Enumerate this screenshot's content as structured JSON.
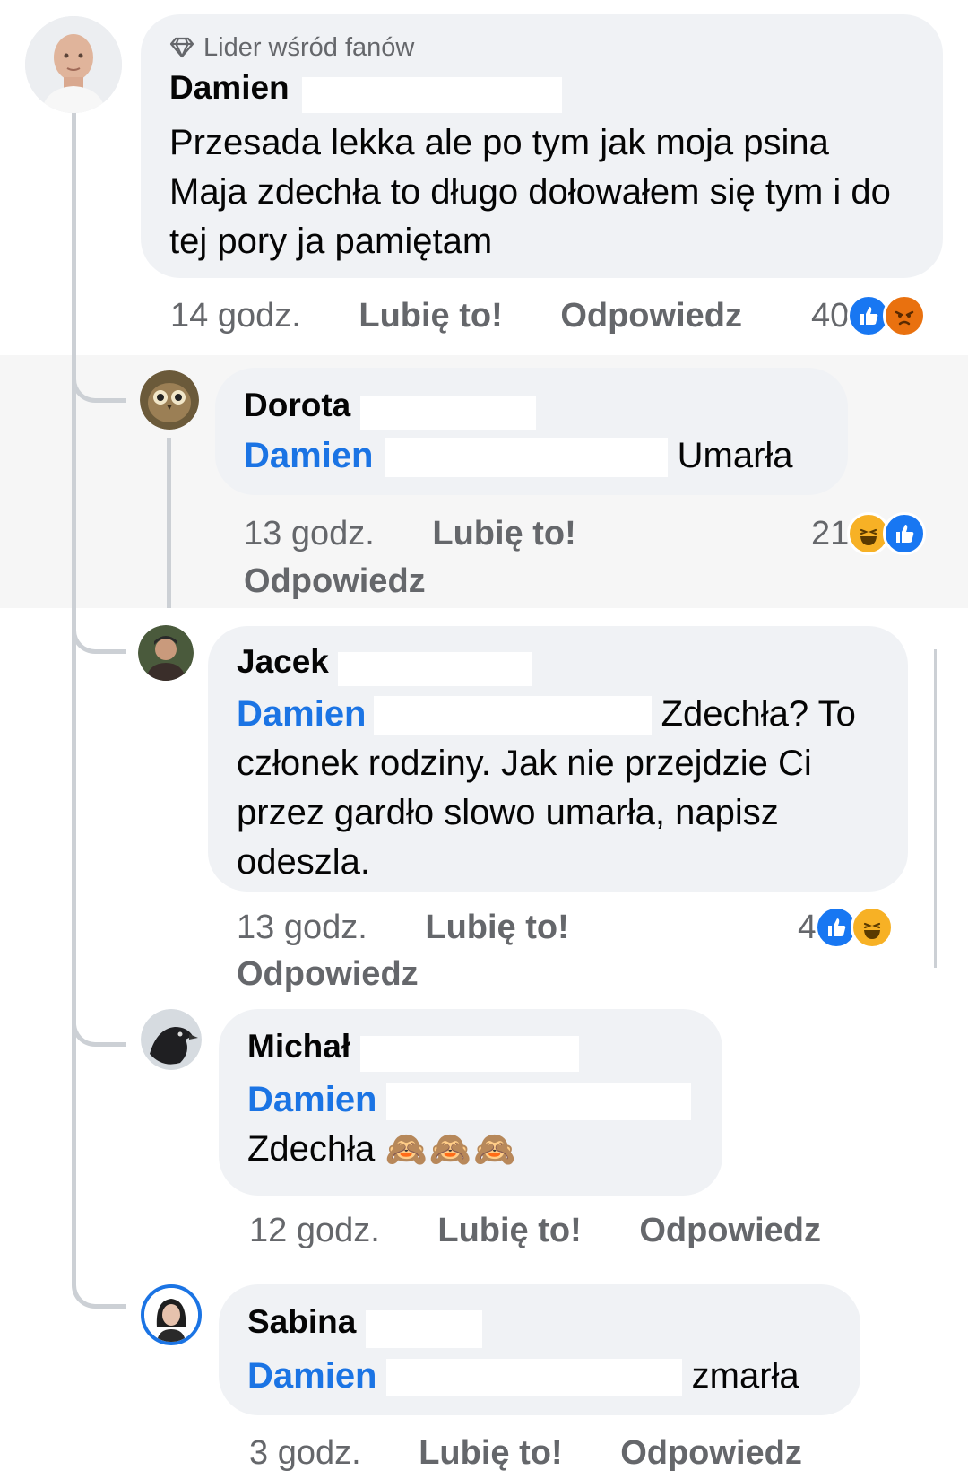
{
  "comments": [
    {
      "badge": "Lider wśród fanów",
      "author": "Damien",
      "text": "Przesada lekka ale po tym jak moja psina Maja zdechła to długo dołowałem się tym i do tej pory ja pamiętam",
      "time": "14 godz.",
      "like": "Lubię to!",
      "reply": "Odpowiedz",
      "reaction_count": "40",
      "reactions": [
        "like-icon",
        "angry-icon"
      ]
    }
  ],
  "replies": [
    {
      "author": "Dorota",
      "mention": "Damien",
      "text": "Umarła",
      "time": "13 godz.",
      "like": "Lubię to!",
      "reply": "Odpowiedz",
      "reaction_count": "21",
      "reactions": [
        "haha-icon",
        "like-icon"
      ]
    },
    {
      "author": "Jacek",
      "mention": "Damien",
      "text_line1": "Zdechła? To",
      "text_rest": "członek rodziny. Jak nie przejdzie Ci przez gardło slowo umarła, napisz odeszla.",
      "time": "13 godz.",
      "like": "Lubię to!",
      "reply": "Odpowiedz",
      "reaction_count": "4",
      "reactions": [
        "like-icon",
        "haha-icon"
      ]
    },
    {
      "author": "Michał",
      "mention": "Damien",
      "text": "Zdechła",
      "emoji": "🙈🙈🙈",
      "time": "12 godz.",
      "like": "Lubię to!",
      "reply": "Odpowiedz"
    },
    {
      "author": "Sabina",
      "mention": "Damien",
      "text": "zmarła",
      "time": "3 godz.",
      "like": "Lubię to!",
      "reply": "Odpowiedz"
    }
  ],
  "colors": {
    "mention": "#1b74e4",
    "bubble": "#f0f2f5",
    "meta": "#65676b",
    "like": "#1877f2",
    "angry": "#e9710f",
    "haha": "#f7b125"
  }
}
